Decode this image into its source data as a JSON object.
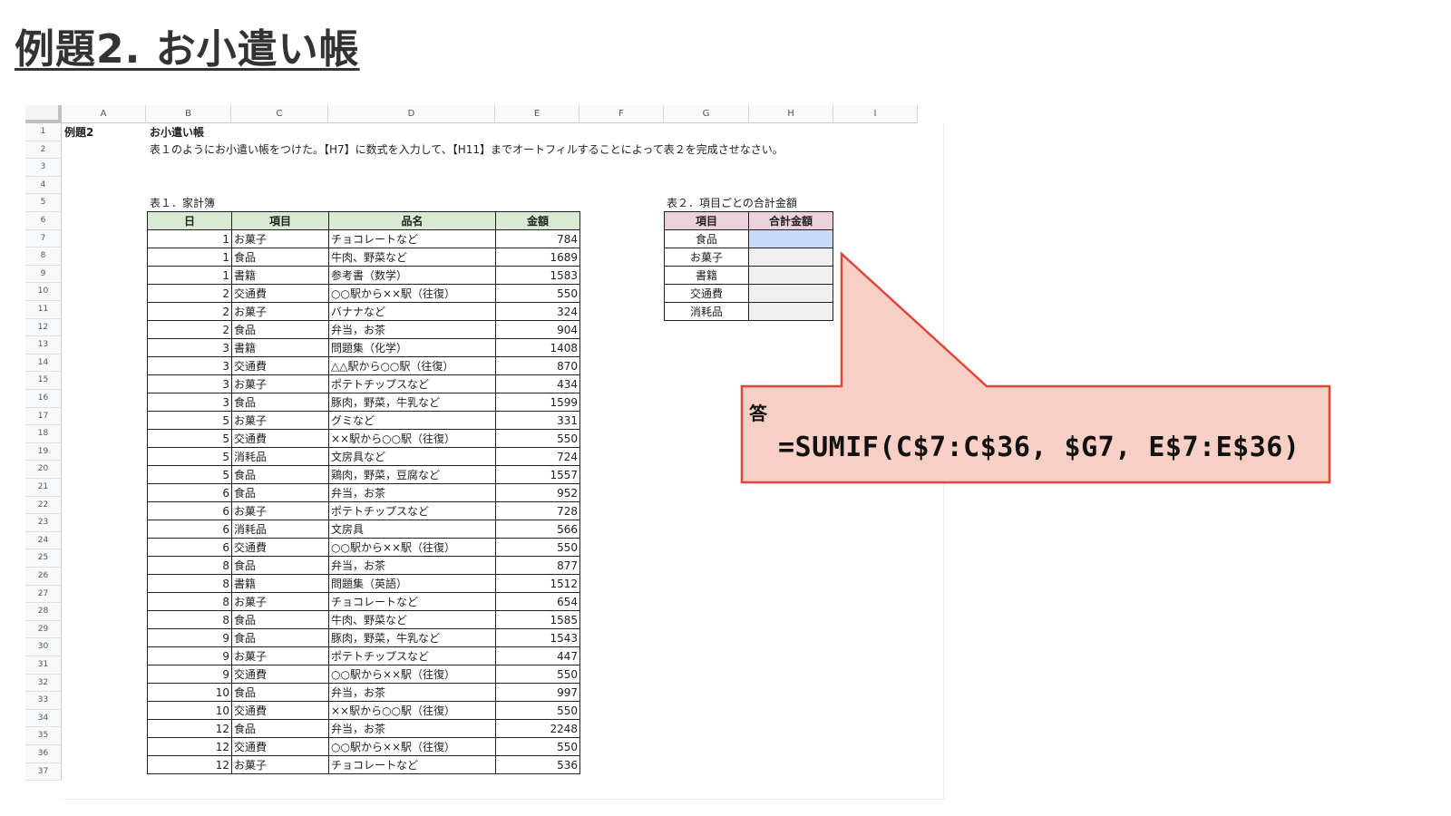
{
  "title": "例題2. お小遣い帳",
  "columns": [
    "A",
    "B",
    "C",
    "D",
    "E",
    "F",
    "G",
    "H",
    "I"
  ],
  "rows": [
    "1",
    "2",
    "3",
    "4",
    "5",
    "6",
    "7",
    "8",
    "9",
    "10",
    "11",
    "12",
    "13",
    "14",
    "15",
    "16",
    "17",
    "18",
    "19",
    "20",
    "21",
    "22",
    "23",
    "24",
    "25",
    "26",
    "27",
    "28",
    "29",
    "30",
    "31",
    "32",
    "33",
    "34",
    "35",
    "36",
    "37"
  ],
  "a1": "例題2",
  "b1": "お小遣い帳",
  "b2": "表１のようにお小遣い帳をつけた。【H7】に数式を入力して、【H11】までオートフィルすることによって表２を完成させなさい。",
  "table1": {
    "caption": "表１．家計簿",
    "headers": [
      "日",
      "項目",
      "品名",
      "金額"
    ],
    "rows": [
      [
        "1",
        "お菓子",
        "チョコレートなど",
        "784"
      ],
      [
        "1",
        "食品",
        "牛肉、野菜など",
        "1689"
      ],
      [
        "1",
        "書籍",
        "参考書（数学）",
        "1583"
      ],
      [
        "2",
        "交通費",
        "○○駅から××駅（往復）",
        "550"
      ],
      [
        "2",
        "お菓子",
        "バナナなど",
        "324"
      ],
      [
        "2",
        "食品",
        "弁当，お茶",
        "904"
      ],
      [
        "3",
        "書籍",
        "問題集（化学）",
        "1408"
      ],
      [
        "3",
        "交通費",
        "△△駅から○○駅（往復）",
        "870"
      ],
      [
        "3",
        "お菓子",
        "ポテトチップスなど",
        "434"
      ],
      [
        "3",
        "食品",
        "豚肉，野菜，牛乳など",
        "1599"
      ],
      [
        "5",
        "お菓子",
        "グミなど",
        "331"
      ],
      [
        "5",
        "交通費",
        "××駅から○○駅（往復）",
        "550"
      ],
      [
        "5",
        "消耗品",
        "文房具など",
        "724"
      ],
      [
        "5",
        "食品",
        "鶏肉，野菜，豆腐など",
        "1557"
      ],
      [
        "6",
        "食品",
        "弁当，お茶",
        "952"
      ],
      [
        "6",
        "お菓子",
        "ポテトチップスなど",
        "728"
      ],
      [
        "6",
        "消耗品",
        "文房具",
        "566"
      ],
      [
        "6",
        "交通費",
        "○○駅から××駅（往復）",
        "550"
      ],
      [
        "8",
        "食品",
        "弁当，お茶",
        "877"
      ],
      [
        "8",
        "書籍",
        "問題集（英語）",
        "1512"
      ],
      [
        "8",
        "お菓子",
        "チョコレートなど",
        "654"
      ],
      [
        "8",
        "食品",
        "牛肉、野菜など",
        "1585"
      ],
      [
        "9",
        "食品",
        "豚肉，野菜，牛乳など",
        "1543"
      ],
      [
        "9",
        "お菓子",
        "ポテトチップスなど",
        "447"
      ],
      [
        "9",
        "交通費",
        "○○駅から××駅（往復）",
        "550"
      ],
      [
        "10",
        "食品",
        "弁当，お茶",
        "997"
      ],
      [
        "10",
        "交通費",
        "××駅から○○駅（往復）",
        "550"
      ],
      [
        "12",
        "食品",
        "弁当，お茶",
        "2248"
      ],
      [
        "12",
        "交通費",
        "○○駅から××駅（往復）",
        "550"
      ],
      [
        "12",
        "お菓子",
        "チョコレートなど",
        "536"
      ]
    ]
  },
  "table2": {
    "caption": "表２．項目ごとの合計金額",
    "headers": [
      "項目",
      "合計金額"
    ],
    "items": [
      "食品",
      "お菓子",
      "書籍",
      "交通費",
      "消耗品"
    ]
  },
  "callout": {
    "label": "答",
    "formula": "=SUMIF(C$7:C$36, $G7, E$7:E$36)",
    "fill": "#f7cfc4",
    "border": "#e0463c"
  }
}
